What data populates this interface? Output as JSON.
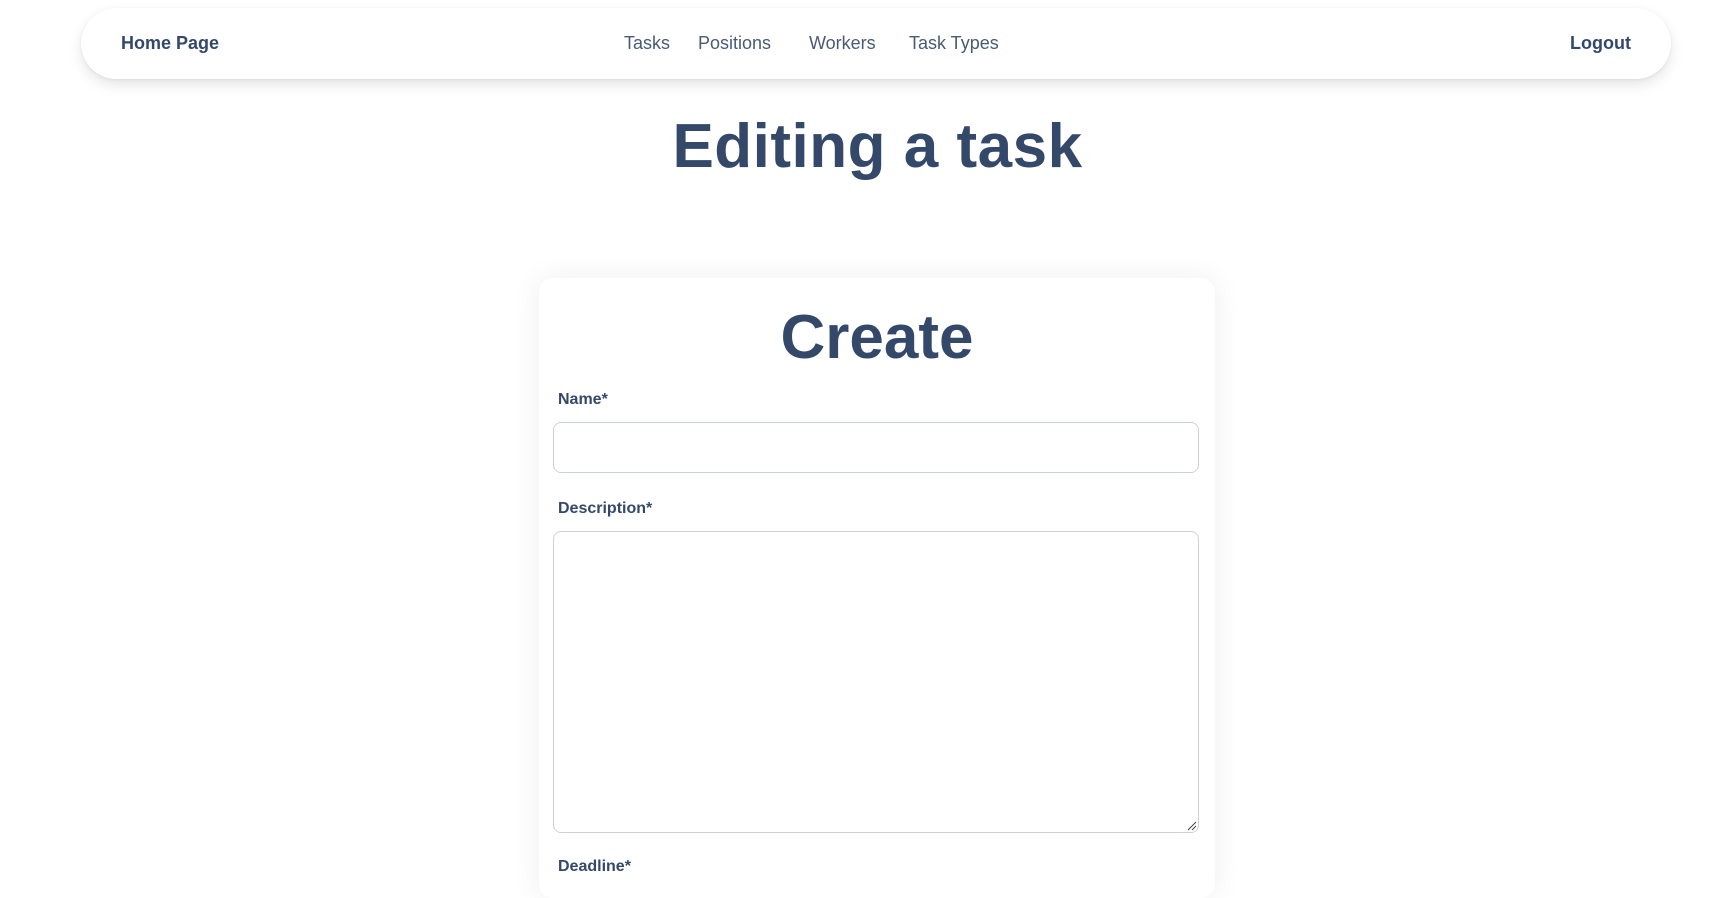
{
  "nav": {
    "home_label": "Home Page",
    "links": [
      {
        "label": "Tasks"
      },
      {
        "label": "Positions"
      },
      {
        "label": "Workers"
      },
      {
        "label": "Task Types"
      }
    ],
    "logout_label": "Logout"
  },
  "page": {
    "title": "Editing a task"
  },
  "form": {
    "title": "Create",
    "name_label": "Name*",
    "name_value": "",
    "description_label": "Description*",
    "description_value": "",
    "deadline_label": "Deadline*"
  },
  "colors": {
    "heading": "#34486a",
    "nav_link": "#4a5a75",
    "input_border": "#cdd1d8"
  }
}
